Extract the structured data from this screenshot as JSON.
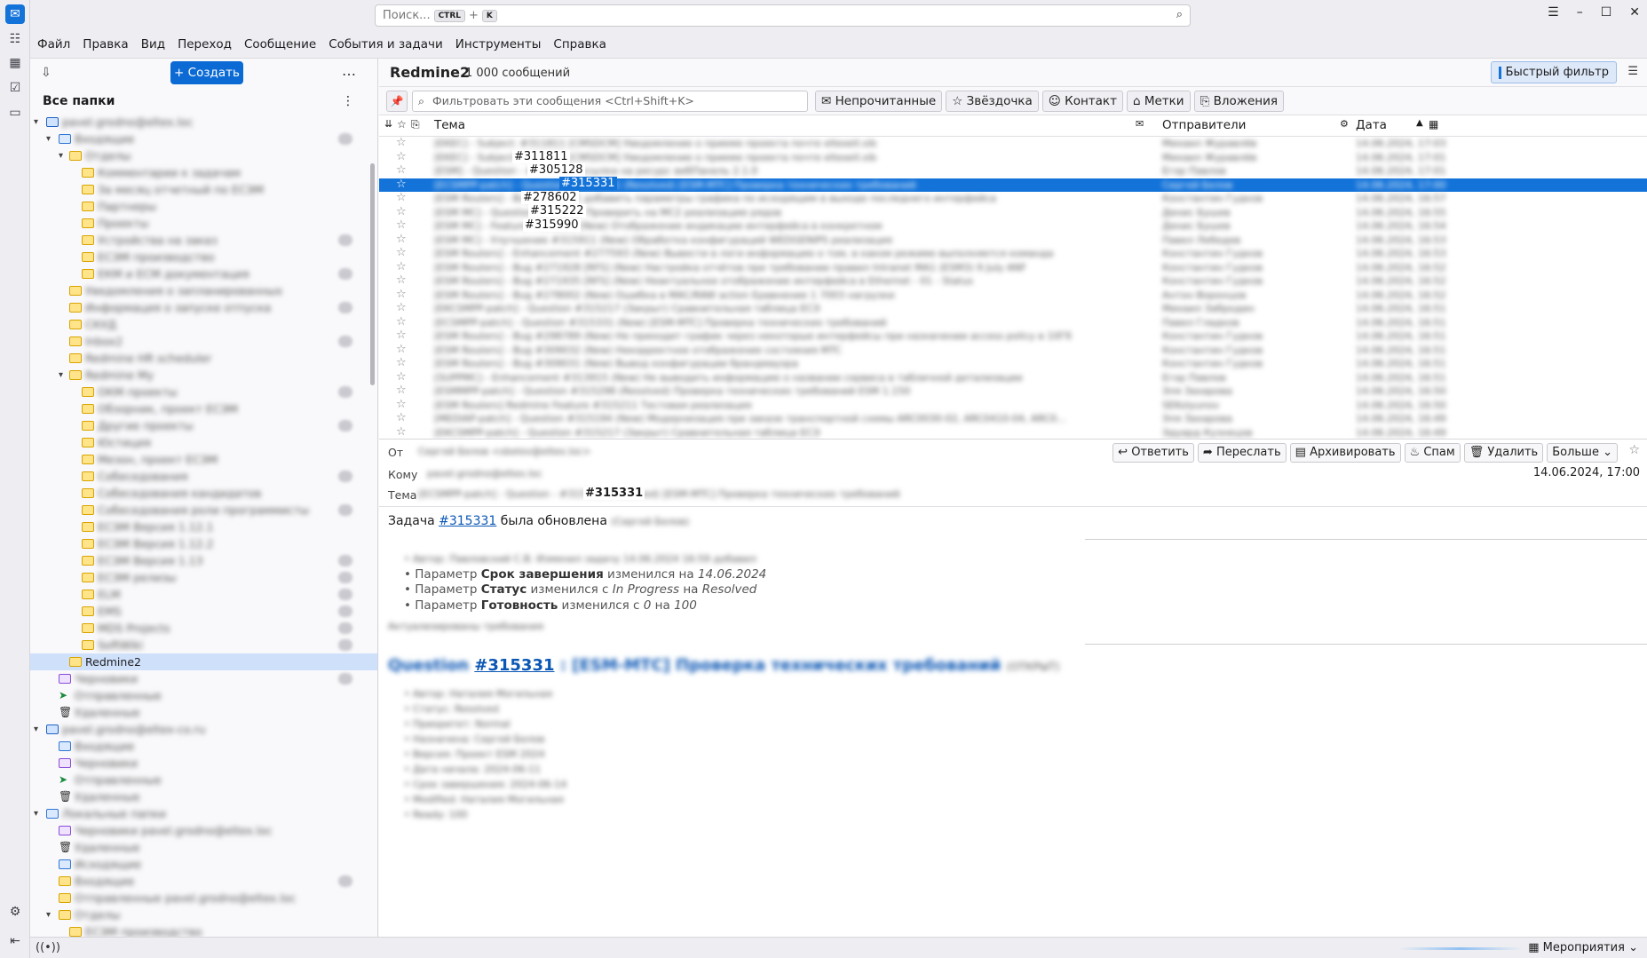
{
  "search": {
    "placeholder": "Поиск...",
    "kbd1": "CTRL",
    "plus": "+",
    "kbd2": "K"
  },
  "menu": [
    "Файл",
    "Правка",
    "Вид",
    "Переход",
    "Сообщение",
    "События и задачи",
    "Инструменты",
    "Справка"
  ],
  "folder_pane": {
    "create_label": "+ Создать",
    "all_folders": "Все папки",
    "selected_folder": "Redmine2"
  },
  "message_list": {
    "folder_name": "Redmine2",
    "count": "1 000 сообщений",
    "quick_filter": "Быстрый фильтр",
    "filter_placeholder": "Фильтровать эти сообщения <Ctrl+Shift+K>",
    "filter_buttons": [
      "Непрочитанные",
      "Звёздочка",
      "Контакт",
      "Метки",
      "Вложения"
    ],
    "columns": {
      "subject": "Тема",
      "senders": "Отправители",
      "date": "Дата"
    },
    "ticket_tags": [
      "#311811",
      "#305128",
      "#315331",
      "#278602",
      "#315222",
      "#315990"
    ]
  },
  "message": {
    "from_label": "От",
    "to_label": "Кому",
    "subject_label": "Тема",
    "subject_ticket": "#315331",
    "date": "14.06.2024, 17:00",
    "actions": [
      "Ответить",
      "Переслать",
      "Архивировать",
      "Спам",
      "Удалить",
      "Больше"
    ],
    "intro_prefix": "Задача",
    "intro_link": "#315331",
    "intro_suffix": "была обновлена",
    "changes": [
      {
        "pre": "Параметр",
        "field": "Срок завершения",
        "mid": "изменился на",
        "val": "14.06.2024"
      },
      {
        "pre": "Параметр",
        "field": "Статус",
        "mid": "изменился с",
        "from": "In Progress",
        "to_word": "на",
        "val": "Resolved"
      },
      {
        "pre": "Параметр",
        "field": "Готовность",
        "mid": "изменился с",
        "from": "0",
        "to_word": "на",
        "val": "100"
      }
    ],
    "issue_link": "#315331"
  },
  "status_bar": {
    "events_label": "Мероприятия"
  }
}
